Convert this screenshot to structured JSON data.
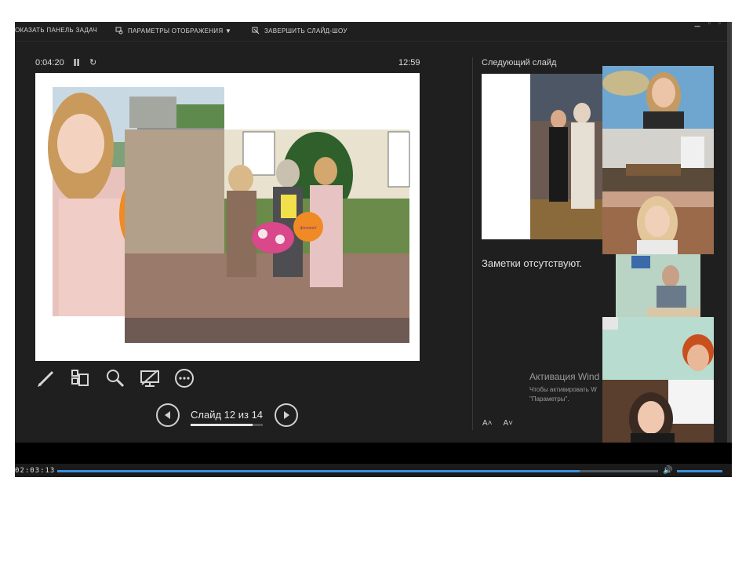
{
  "toolbar": {
    "show_taskbar": "ОКАЗАТЬ ПАНЕЛЬ ЗАДАЧ",
    "display_settings": "ПАРАМЕТРЫ ОТОБРАЖЕНИЯ ▼",
    "end_slideshow": "ЗАВЕРШИТЬ СЛАЙД-ШОУ"
  },
  "presenter": {
    "elapsed": "0:04:20",
    "clock": "12:59",
    "slide_counter": "Слайд 12 из 14",
    "progress_fraction": 0.857
  },
  "slide": {
    "balloon_text": "Факультет філології",
    "small_balloon_text": "філології"
  },
  "next_slide": {
    "label": "Следующий слайд"
  },
  "notes": {
    "text": "Заметки отсутствуют."
  },
  "activation": {
    "title": "Активация Wind",
    "line1": "Чтобы активировать W",
    "line2": "\"Параметры\"."
  },
  "font_controls": {
    "increase": "A˄",
    "decrease": "A˅"
  },
  "player": {
    "time": "02:03:13",
    "progress_fraction": 0.87
  },
  "colors": {
    "accent": "#3d8ed6",
    "balloon": "#f08a24",
    "background": "#1f1f1f"
  }
}
